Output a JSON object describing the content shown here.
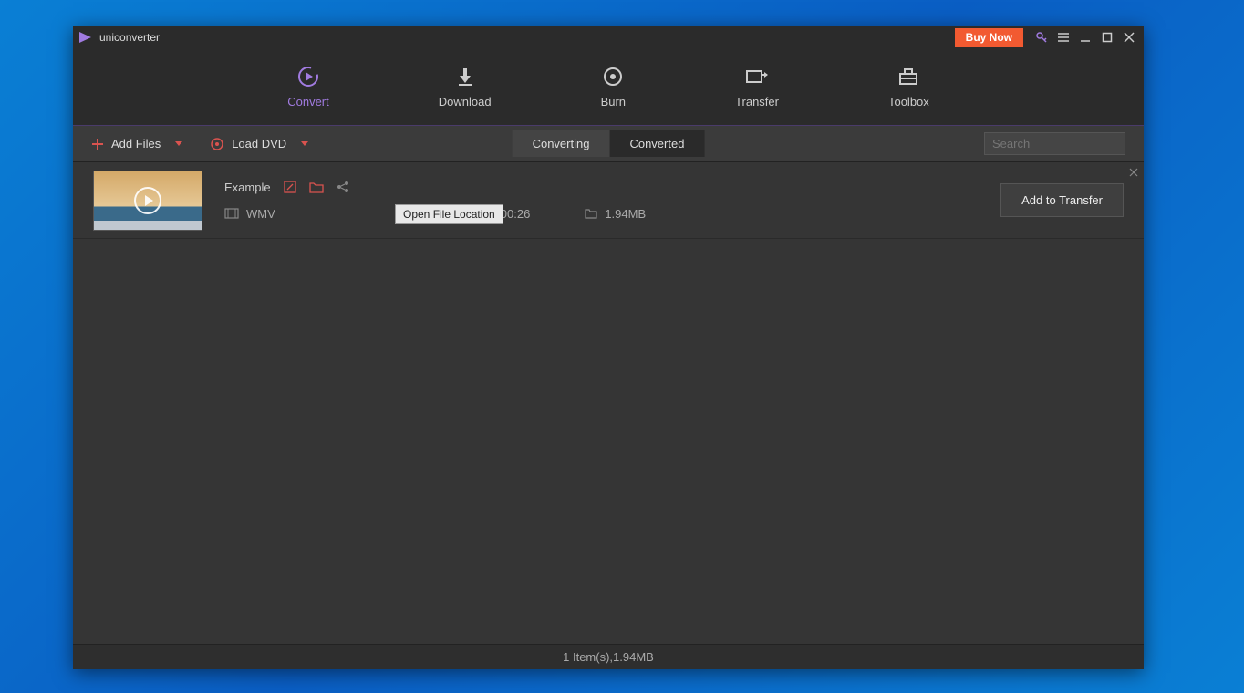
{
  "titlebar": {
    "app_name": "uniconverter",
    "buy_now": "Buy Now"
  },
  "nav": {
    "convert": "Convert",
    "download": "Download",
    "burn": "Burn",
    "transfer": "Transfer",
    "toolbox": "Toolbox"
  },
  "toolbar": {
    "add_files": "Add Files",
    "load_dvd": "Load DVD",
    "converting": "Converting",
    "converted": "Converted",
    "search_placeholder": "Search"
  },
  "file": {
    "name": "Example",
    "format": "WMV",
    "duration": "00:26",
    "size": "1.94MB",
    "add_to_transfer": "Add to Transfer",
    "tooltip": "Open File Location"
  },
  "status": {
    "text": "1 Item(s),1.94MB"
  }
}
